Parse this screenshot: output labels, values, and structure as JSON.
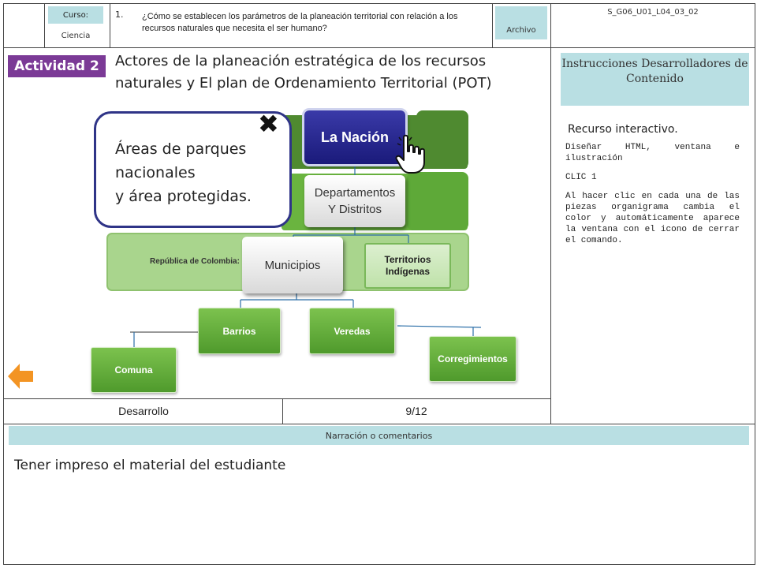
{
  "header": {
    "curso_label": "Curso:",
    "curso_value": "Ciencia",
    "question_number": "1.",
    "question": "¿Cómo se establecen los parámetros de la planeación territorial con relación a los recursos naturales que necesita el ser humano?",
    "archivo_label": "Archivo",
    "file_code": "S_G06_U01_L04_03_02"
  },
  "activity": {
    "badge": "Actividad 2",
    "title": "Actores de la planeación estratégica de los recursos naturales y El plan de Ordenamiento Territorial (POT)"
  },
  "diagram": {
    "nodes": {
      "nacion": "La Nación",
      "departamentos_line1": "Departamentos",
      "departamentos_line2": "Y Distritos",
      "republica": "República de Colombia:",
      "municipios": "Municipios",
      "territorios_line1": "Territorios",
      "territorios_line2": "Indígenas",
      "barrios": "Barrios",
      "veredas": "Veredas",
      "comuna": "Comuna",
      "corregimientos": "Corregimientos"
    },
    "popup": {
      "line1": "Áreas de parques",
      "line2": "nacionales",
      "line3": "y área protegidas."
    }
  },
  "instructions": {
    "box_title": "Instrucciones Desarrolladores de Contenido",
    "heading": "Recurso interactivo.",
    "p1": "Diseñar HTML, ventana e ilustración",
    "p2": "CLIC 1",
    "p3": "Al hacer clic en cada una de las piezas organigrama cambia el color y automáticamente aparece la ventana con el icono de cerrar el comando."
  },
  "footer": {
    "section": "Desarrollo",
    "page": "9/12"
  },
  "narration": {
    "label": "Narración o comentarios",
    "text": "Tener impreso el material del estudiante"
  },
  "icons": {
    "close": "close-x-icon",
    "hand": "pointer-hand-icon",
    "back": "back-arrow-icon"
  },
  "colors": {
    "activity_badge": "#7b3a96",
    "light_teal": "#b9dfe3",
    "nacion_blue": "#1a1a7a",
    "green_node": "#5ba835",
    "back_arrow": "#f39423"
  }
}
